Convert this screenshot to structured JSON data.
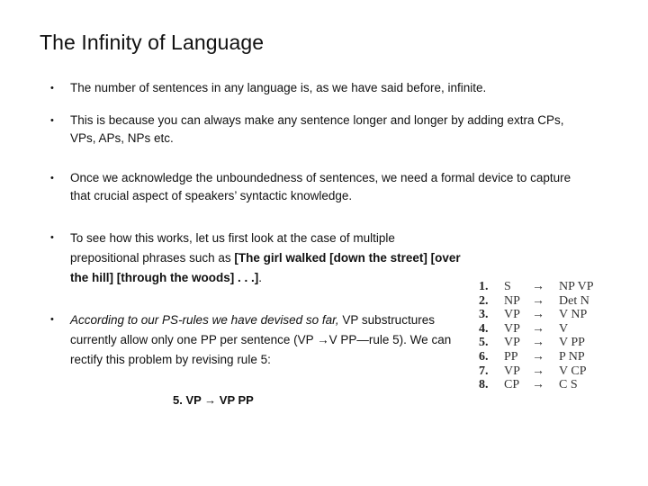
{
  "slide": {
    "title": "The Infinity of Language",
    "bullet_glyph": "•",
    "bullets": [
      {
        "text": "The number of sentences in any language is, as we have said before, infinite."
      },
      {
        "text": "This is because you can always make any sentence longer and longer by adding extra CPs,  VPs, APs, NPs etc."
      },
      {
        "text": "Once we acknowledge the unboundedness of sentences, we need a formal device to capture that crucial aspect of speakers’ syntactic knowledge."
      },
      {
        "text_plain": "To see how this works, let us first look at the case of multiple prepositional phrases such as ",
        "text_bold": "[The girl walked [down the street] [over the hill] [through the woods] . . .]",
        "text_end": "."
      },
      {
        "text_italic": "According to our PS-rules we have devised so far,",
        "text_plain": " VP substructures currently allow only one PP per sentence (VP →V PP—rule 5). We can rectify this problem by revising rule 5:"
      }
    ],
    "revised_rule": "5. VP → VP PP",
    "rules": [
      {
        "num": "1.",
        "lhs": "S",
        "arrow": "→",
        "rhs": "NP VP"
      },
      {
        "num": "2.",
        "lhs": "NP",
        "arrow": "→",
        "rhs": "Det N"
      },
      {
        "num": "3.",
        "lhs": "VP",
        "arrow": "→",
        "rhs": "V NP"
      },
      {
        "num": "4.",
        "lhs": "VP",
        "arrow": "→",
        "rhs": "V"
      },
      {
        "num": "5.",
        "lhs": "VP",
        "arrow": "→",
        "rhs": "V PP"
      },
      {
        "num": "6.",
        "lhs": "PP",
        "arrow": "→",
        "rhs": "P NP"
      },
      {
        "num": "7.",
        "lhs": "VP",
        "arrow": "→",
        "rhs": "V CP"
      },
      {
        "num": "8.",
        "lhs": "CP",
        "arrow": "→",
        "rhs": "C S"
      }
    ]
  }
}
